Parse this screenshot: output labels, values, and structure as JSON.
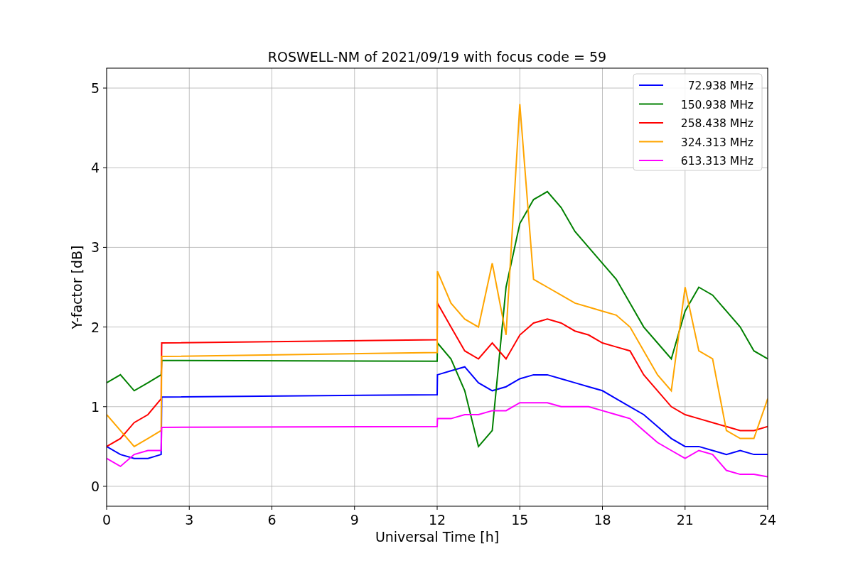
{
  "chart": {
    "chart_data": {
      "type": "line",
      "title": "ROSWELL-NM of 2021/09/19 with focus code = 59",
      "xlabel": "Universal Time [h]",
      "ylabel": "Y-factor [dB]",
      "x": [
        0,
        0.5,
        1,
        1.5,
        1.98,
        2,
        12,
        12.01,
        12.5,
        13,
        13.5,
        14,
        14.5,
        15,
        15.5,
        16,
        16.5,
        17,
        17.5,
        18,
        18.5,
        19,
        19.5,
        20,
        20.5,
        21,
        21.5,
        22,
        22.5,
        23,
        23.5,
        24
      ],
      "series": [
        {
          "name": "72.938 MHz",
          "color": "#0000ff",
          "values": [
            0.5,
            0.4,
            0.35,
            0.35,
            0.4,
            1.12,
            1.15,
            1.4,
            1.45,
            1.5,
            1.3,
            1.2,
            1.25,
            1.35,
            1.4,
            1.4,
            1.35,
            1.3,
            1.25,
            1.2,
            1.1,
            1.0,
            0.9,
            0.75,
            0.6,
            0.5,
            0.5,
            0.45,
            0.4,
            0.45,
            0.4,
            0.4
          ]
        },
        {
          "name": "150.938 MHz",
          "color": "#008000",
          "values": [
            1.3,
            1.4,
            1.2,
            1.3,
            1.4,
            1.58,
            1.57,
            1.8,
            1.6,
            1.2,
            0.5,
            0.7,
            2.5,
            3.3,
            3.6,
            3.7,
            3.5,
            3.2,
            3.0,
            2.8,
            2.6,
            2.3,
            2.0,
            1.8,
            1.6,
            2.2,
            2.5,
            2.4,
            2.2,
            2.0,
            1.7,
            1.6
          ]
        },
        {
          "name": "258.438 MHz",
          "color": "#ff0000",
          "values": [
            0.5,
            0.6,
            0.8,
            0.9,
            1.1,
            1.8,
            1.84,
            2.3,
            2.0,
            1.7,
            1.6,
            1.8,
            1.6,
            1.9,
            2.05,
            2.1,
            2.05,
            1.95,
            1.9,
            1.8,
            1.75,
            1.7,
            1.4,
            1.2,
            1.0,
            0.9,
            0.85,
            0.8,
            0.75,
            0.7,
            0.7,
            0.75
          ]
        },
        {
          "name": "324.313 MHz",
          "color": "#ffa500",
          "values": [
            0.9,
            0.7,
            0.5,
            0.6,
            0.7,
            1.63,
            1.68,
            2.7,
            2.3,
            2.1,
            2.0,
            2.8,
            1.9,
            4.8,
            2.6,
            2.5,
            2.4,
            2.3,
            2.25,
            2.2,
            2.15,
            2.0,
            1.7,
            1.4,
            1.2,
            2.5,
            1.7,
            1.6,
            0.7,
            0.6,
            0.6,
            1.1
          ]
        },
        {
          "name": "613.313 MHz",
          "color": "#ff00ff",
          "values": [
            0.35,
            0.25,
            0.4,
            0.45,
            0.45,
            0.74,
            0.75,
            0.85,
            0.85,
            0.9,
            0.9,
            0.95,
            0.95,
            1.05,
            1.05,
            1.05,
            1.0,
            1.0,
            1.0,
            0.95,
            0.9,
            0.85,
            0.7,
            0.55,
            0.45,
            0.35,
            0.45,
            0.4,
            0.2,
            0.15,
            0.15,
            0.12
          ]
        }
      ],
      "xlim": [
        0,
        24
      ],
      "ylim": [
        -0.25,
        5.25
      ],
      "xticks": [
        0,
        3,
        6,
        9,
        12,
        15,
        18,
        21,
        24
      ],
      "yticks": [
        0,
        1,
        2,
        3,
        4,
        5
      ],
      "grid": true,
      "legend": "upper right"
    }
  }
}
